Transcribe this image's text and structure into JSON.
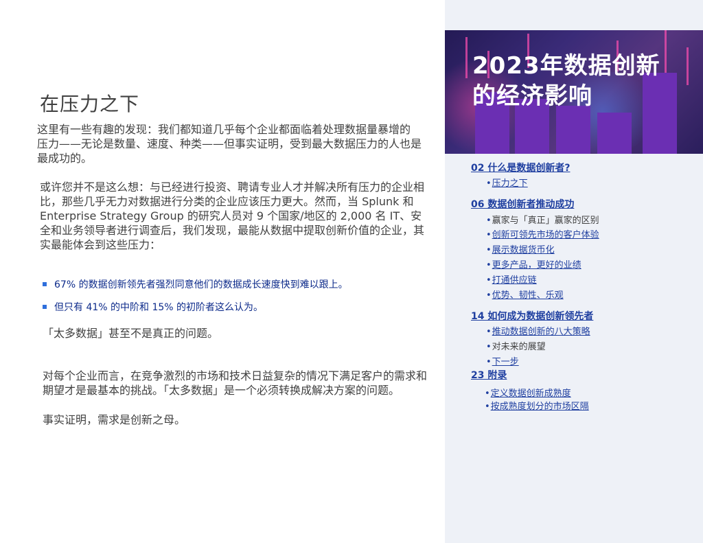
{
  "main": {
    "heading": "在压力之下",
    "p1": "这里有一些有趣的发现：我们都知道几乎每个企业都面临着处理数据量暴增的 压力——无论是数量、速度、种类——但事实证明，受到最大数据压力的人也是最成功的。",
    "p2": "或许您并不是这么想：与已经进行投资、聘请专业人才并解决所有压力的企业相比，那些几乎无力对数据进行分类的企业应该压力更大。然而，当 Splunk 和Enterprise Strategy Group 的研究人员对 9 个国家/地区的 2,000 名 IT、安全和业务领导者进行调查后，我们发现，最能从数据中提取创新价值的企业，其实最能体会到这些压力：",
    "bullets": [
      "67% 的数据创新领先者强烈同意他们的数据成长速度快到难以跟上。",
      "但只有 41% 的中阶和 15% 的初阶者这么认为。"
    ],
    "p3": "「太多数据」甚至不是真正的问题。",
    "p4": "对每个企业而言，在竞争激烈的市场和技术日益复杂的情况下满足客户的需求和期望才是最基本的挑战。「太多数据」是一个必须转换成解决方案的问题。",
    "p5": "事实证明，需求是创新之母。"
  },
  "hero": {
    "title_line1": "2023年数据创新",
    "title_line2": "的经济影响"
  },
  "toc": {
    "s1": {
      "title": "02 什么是数据创新者?",
      "items": [
        "压力之下"
      ]
    },
    "s2": {
      "title": "06 数据创新者推动成功",
      "items": [
        "赢家与「真正」赢家的区别",
        "创新可领先市场的客户体验",
        "展示数据货币化",
        "更多产品，更好的业绩",
        "打通供应链",
        "优势、韧性、乐观"
      ]
    },
    "s3": {
      "title": "14 如何成为数据创新领先者",
      "items": [
        "推动数据创新的八大策略",
        "对未来的展望",
        "下一步"
      ]
    },
    "s4": {
      "title": "23 附录",
      "items": [
        "定义数据创新成熟度",
        "按成熟度划分的市场区隔"
      ]
    }
  }
}
